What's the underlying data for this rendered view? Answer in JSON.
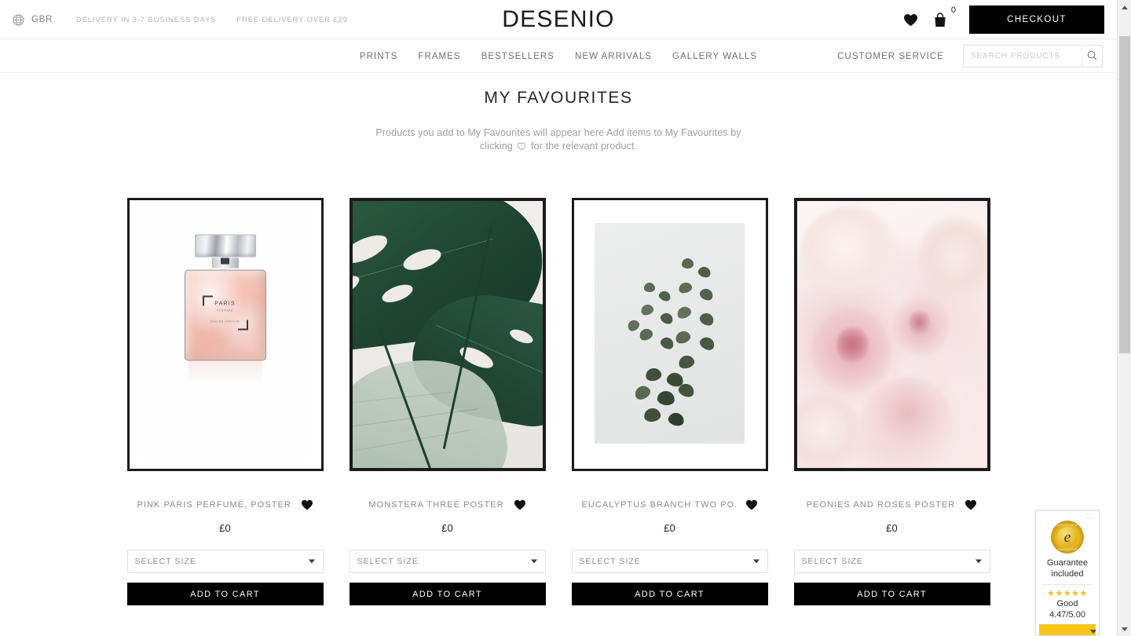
{
  "topbar": {
    "country_icon": "globe-icon",
    "country": "GBR",
    "delivery_message": "DELIVERY IN 3-7 BUSINESS DAYS",
    "free_delivery_message": "FREE DELIVERY OVER £29",
    "brand": "DESENIO",
    "wishlist_icon": "heart-icon",
    "cart_icon": "bag-icon",
    "cart_count": "0",
    "checkout_label": "CHECKOUT"
  },
  "nav": {
    "items": [
      {
        "label": "PRINTS"
      },
      {
        "label": "FRAMES"
      },
      {
        "label": "BESTSELLERS"
      },
      {
        "label": "NEW ARRIVALS"
      },
      {
        "label": "GALLERY WALLS"
      }
    ],
    "customer_service": "CUSTOMER SERVICE",
    "search_placeholder": "SEARCH PRODUCTS",
    "search_value": "",
    "search_icon": "magnifier-icon"
  },
  "page": {
    "title": "MY FAVOURITES",
    "description_part1": "Products you add to My Favourites will appear here Add items to My Favourites by clicking",
    "description_part2": "for the relevant product.",
    "description_icon": "heart-outline-icon"
  },
  "products": [
    {
      "name": "PINK PARIS PERFUME, POSTER",
      "price": "£0",
      "size_label": "SELECT SIZE",
      "add_to_cart": "ADD TO CART",
      "fav_icon": "heart-filled-icon",
      "art": "pink-paris-perfume",
      "art_caption_line1": "PARIS",
      "art_caption_line2": "PERFUME",
      "art_caption_line3": "EAU DE PARFUM"
    },
    {
      "name": "MONSTERA THREE POSTER",
      "price": "£0",
      "size_label": "SELECT SIZE",
      "add_to_cart": "ADD TO CART",
      "fav_icon": "heart-filled-icon",
      "art": "monstera-three"
    },
    {
      "name": "EUCALYPTUS BRANCH TWO PO..",
      "price": "£0",
      "size_label": "SELECT SIZE",
      "add_to_cart": "ADD TO CART",
      "fav_icon": "heart-filled-icon",
      "art": "eucalyptus-branch-two"
    },
    {
      "name": "PEONIES AND ROSES POSTER",
      "price": "£0",
      "size_label": "SELECT SIZE",
      "add_to_cart": "ADD TO CART",
      "fav_icon": "heart-filled-icon",
      "art": "peonies-and-roses"
    }
  ],
  "trust_badge": {
    "menu_dots": "...",
    "seal_text_top": "TRUSTED SHOPS",
    "seal_text_bottom": "GUARANTEE",
    "seal_letter": "e",
    "line1": "Guarantee",
    "line2": "included",
    "stars": "★★★★★",
    "rating_word": "Good",
    "rating_value": "4.47/5.00"
  },
  "colors": {
    "accent_black": "#000000",
    "muted_text": "#8a8a8a",
    "badge_yellow": "#f5c518",
    "star_yellow": "#f0bf28"
  }
}
